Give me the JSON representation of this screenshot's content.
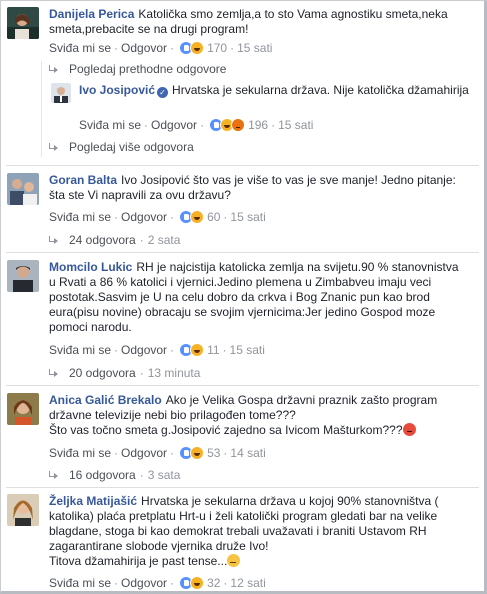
{
  "actions": {
    "like": "Sviđa mi se",
    "reply": "Odgovor",
    "sep": "·"
  },
  "comments": [
    {
      "author": "Danijela Perica",
      "text": "Katolička smo zemlja,a to sto Vama agnostiku smeta,neka smeta,prebacite se na drugi program!",
      "reaction_count": "170",
      "time": "15 sati",
      "reactions": [
        "like",
        "haha"
      ]
    },
    {
      "view_previous": "Pogledaj prethodne odgovore"
    },
    {
      "author": "Ivo Josipović",
      "verified": true,
      "text": "Hrvatska je sekularna država. Nije katolička džamahirija",
      "reaction_count": "196",
      "time": "15 sati",
      "reactions": [
        "like",
        "haha",
        "angry"
      ]
    },
    {
      "view_more": "Pogledaj više odgovora"
    },
    {
      "author": "Goran Balta",
      "text": "Ivo Josipović što vas je više to vas je sve manje! Jedno pitanje: šta ste Vi napravili za ovu državu?",
      "reaction_count": "60",
      "time": "15 sati",
      "reactions": [
        "like",
        "haha"
      ],
      "replies": "24 odgovora",
      "replies_time": "2 sata"
    },
    {
      "author": "Momcilo Lukic",
      "text": "RH je najcistija katolicka zemlja na svijetu.90 % stanovnistva u Rvati a 86 % katolici i vjernici.Jedino plemena u Zimbabveu imaju veci postotak.Sasvim je U na celu dobro da crkva i Bog Znanic pun kao brod eura(pisu novine) obracaju se svojim vjernicima:Jer jedino Gospod moze pomoci narodu.",
      "reaction_count": "11",
      "time": "15 sati",
      "reactions": [
        "like",
        "haha"
      ],
      "replies": "20 odgovora",
      "replies_time": "13 minuta"
    },
    {
      "author": "Anica Galić Brekalo",
      "text": "Ako je Velika Gospa državni praznik zašto program državne televizije nebi bio prilagođen tome???",
      "text2": "Što vas točno smeta g.Josipović zajedno sa Ivicom Mašturkom???",
      "reaction_count": "53",
      "time": "14 sati",
      "reactions": [
        "like",
        "haha"
      ],
      "replies": "16 odgovora",
      "replies_time": "3 sata"
    },
    {
      "author": "Željka Matijašić",
      "text": "Hrvatska je sekularna država u kojoj 90% stanovništva ( katolika) plaća pretplatu Hrt-u i želi katolički program gledati bar na velike blagdane, stoga bi kao demokrat trebali uvažavati i braniti Ustavom RH zagarantirane slobode vjernika druže Ivo!",
      "text2": "Titova džamahirija je past tense...",
      "reaction_count": "32",
      "time": "12 sati",
      "reactions": [
        "like",
        "haha"
      ]
    }
  ],
  "colors": {
    "author": "#365899",
    "meta": "#90949c",
    "like": "#5890ff",
    "haha": "#f7b125",
    "angry": "#e9710f"
  }
}
